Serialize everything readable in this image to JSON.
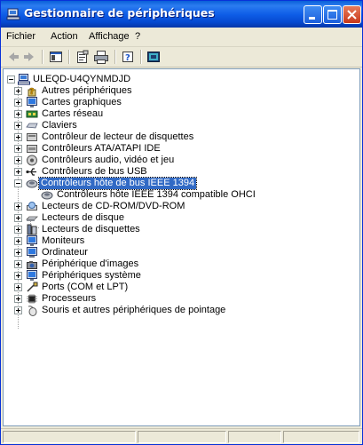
{
  "window": {
    "title": "Gestionnaire de périphériques",
    "title_icon": "computer-icon"
  },
  "titlebar_buttons": [
    "minimize",
    "maximize",
    "close"
  ],
  "menu": [
    "Fichier",
    "Action",
    "Affichage",
    "?"
  ],
  "toolbar": [
    "back-arrow-icon",
    "forward-arrow-icon",
    "show-hide-tree-icon",
    "properties-icon",
    "print-icon",
    "help-icon",
    "view-devices-icon"
  ],
  "tree": {
    "root": {
      "label": "ULEQD-U4QYNMDJD",
      "icon": "computer-icon"
    },
    "items": [
      {
        "label": "Autres périphériques",
        "icon": "unknown-device-icon",
        "expanded": false
      },
      {
        "label": "Cartes graphiques",
        "icon": "monitor-icon",
        "expanded": false
      },
      {
        "label": "Cartes réseau",
        "icon": "network-card-icon",
        "expanded": false
      },
      {
        "label": "Claviers",
        "icon": "keyboard-icon",
        "expanded": false
      },
      {
        "label": "Contrôleur de lecteur de disquettes",
        "icon": "floppy-controller-icon",
        "expanded": false
      },
      {
        "label": "Contrôleurs ATA/ATAPI IDE",
        "icon": "ide-controller-icon",
        "expanded": false
      },
      {
        "label": "Contrôleurs audio, vidéo et jeu",
        "icon": "audio-icon",
        "expanded": false
      },
      {
        "label": "Contrôleurs de bus USB",
        "icon": "usb-icon",
        "expanded": false
      },
      {
        "label": "Contrôleurs hôte de bus IEEE 1394",
        "icon": "ieee1394-icon",
        "expanded": true,
        "selected": true,
        "children": [
          {
            "label": "Contrôleurs hôte IEEE 1394 compatible OHCI",
            "icon": "ieee1394-icon"
          }
        ]
      },
      {
        "label": "Lecteurs de CD-ROM/DVD-ROM",
        "icon": "cdrom-icon",
        "expanded": false
      },
      {
        "label": "Lecteurs de disque",
        "icon": "disk-drive-icon",
        "expanded": false
      },
      {
        "label": "Lecteurs de disquettes",
        "icon": "floppy-drive-icon",
        "expanded": false
      },
      {
        "label": "Moniteurs",
        "icon": "monitor-icon",
        "expanded": false
      },
      {
        "label": "Ordinateur",
        "icon": "computer-icon",
        "expanded": false
      },
      {
        "label": "Périphérique d'images",
        "icon": "camera-icon",
        "expanded": false
      },
      {
        "label": "Périphériques système",
        "icon": "system-device-icon",
        "expanded": false
      },
      {
        "label": "Ports (COM et LPT)",
        "icon": "port-icon",
        "expanded": false
      },
      {
        "label": "Processeurs",
        "icon": "processor-icon",
        "expanded": false
      },
      {
        "label": "Souris et autres périphériques de pointage",
        "icon": "mouse-icon",
        "expanded": false
      }
    ]
  },
  "colors": {
    "titlebar": "#0a5fd8",
    "selection": "#316ac5",
    "close_button": "#c8391b",
    "window_bg": "#ece9d8"
  }
}
